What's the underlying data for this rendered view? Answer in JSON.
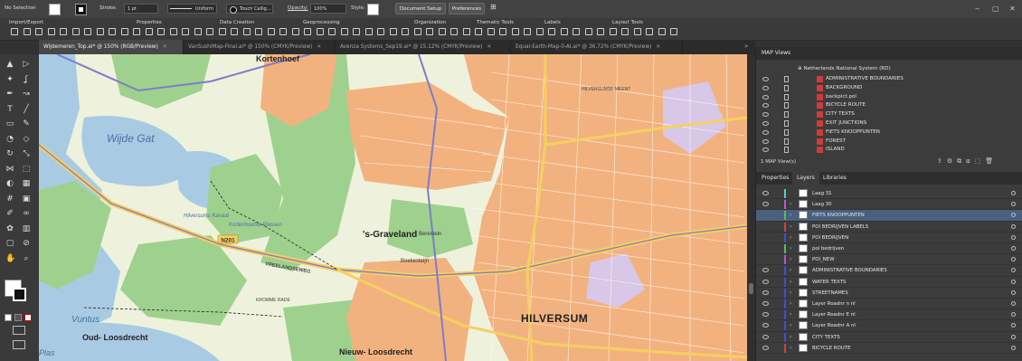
{
  "control_bar": {
    "selection": "No Selection",
    "stroke_label": "Stroke:",
    "stroke_weight": "1 pt",
    "profile": "Uniform",
    "brush": "Touch Callig...",
    "opacity_label": "Opacity:",
    "opacity_value": "100%",
    "style_label": "Style:",
    "doc_setup": "Document Setup",
    "preferences": "Preferences",
    "window_min": "‒",
    "window_max": "▢",
    "window_close": "✕"
  },
  "mapviews_toolbar": {
    "groups": [
      "Import/Export",
      "Properties",
      "Data Creation",
      "Geoprocessing",
      "Organization",
      "Thematic Tools",
      "Labels",
      "Layout Tools"
    ]
  },
  "tabs": [
    {
      "label": "Wijdemeren_Top.ai* @ 150% (RGB/Preview)",
      "active": true
    },
    {
      "label": "VanSushiMap-Final.ai* @ 150% (CMYK/Preview)",
      "active": false
    },
    {
      "label": "Avenza Systems_Sep19.ai* @ 15.12% (CMYK/Preview)",
      "active": false
    },
    {
      "label": "Equal-Earth-Map-0-AI.ai* @ 36.72% (CMYK/Preview)",
      "active": false
    }
  ],
  "tab_close": "✕",
  "tab_overflow": "»",
  "tools": [
    "selection-tool",
    "direct-selection-tool",
    "magic-wand-tool",
    "lasso-tool",
    "pen-tool",
    "curvature-tool",
    "type-tool",
    "line-tool",
    "rectangle-tool",
    "paintbrush-tool",
    "shaper-tool",
    "eraser-tool",
    "rotate-tool",
    "scale-tool",
    "width-tool",
    "free-transform-tool",
    "shape-builder-tool",
    "perspective-tool",
    "mesh-tool",
    "gradient-tool",
    "eyedropper-tool",
    "blend-tool",
    "symbol-sprayer-tool",
    "graph-tool",
    "artboard-tool",
    "slice-tool",
    "hand-tool",
    "zoom-tool"
  ],
  "tool_glyphs": [
    "▲",
    "▷",
    "✦",
    "ʆ",
    "✒",
    "↝",
    "T",
    "╱",
    "▭",
    "✎",
    "◔",
    "◇",
    "↻",
    "⤡",
    "⋈",
    "⬚",
    "◐",
    "▦",
    "#",
    "▣",
    "✐",
    "∞",
    "✿",
    "▥",
    "▢",
    "⊘",
    "✋",
    "⌕"
  ],
  "map": {
    "water_color": "#a8cbe3",
    "urban_color": "#f2b27f",
    "green_color": "#9fd18e",
    "land_color": "#eef2dc",
    "labels": {
      "kortenhoef": "Kortenhoef",
      "wijde_gat": "Wijde Gat",
      "graveland": "'s-Graveland",
      "hilversum": "HILVERSUM",
      "vuntus": "Vuntus",
      "oud_loosdrecht": "Oud-\nLoosdrecht",
      "nieuw_loosdrecht": "Nieuw-\nLoosdrecht",
      "plas": "Plas",
      "n201": "N201",
      "hilversums_kanaal": "Hilversums\nKanaal",
      "kortenhoefse_plassen": "Kortenhoefse\nPlassen",
      "vreelandseweg": "VREELANDSEWEG",
      "kromme_rade": "KROMME RADE",
      "boekesteijn": "Boekesteijn",
      "berestein": "Berestein",
      "hilversumse_meent": "HILVERSUMSE MEENT"
    }
  },
  "map_views_panel": {
    "title": "MAP Views",
    "root": "Netherlands National System (RD)",
    "items": [
      "ADMINISTRATIVE BOUNDARIES",
      "BACKGROUND",
      "backpict.pol",
      "BICYCLE ROUTE",
      "CITY TEXTS",
      "EXIT JUNCTIONS",
      "FIETS KNOOPPUNTEN",
      "FOREST",
      "ISLAND"
    ],
    "footer": "1 MAP View(s)"
  },
  "panel_tabs": [
    "Properties",
    "Layers",
    "Libraries"
  ],
  "layers": [
    {
      "name": "Laag 31",
      "color": "#4fd0d0",
      "eye": true,
      "expand": false
    },
    {
      "name": "Laag 30",
      "color": "#d04fd0",
      "eye": true,
      "expand": true
    },
    {
      "name": "FIETS KNOOPPUNTEN",
      "color": "#52c052",
      "eye": false,
      "expand": true,
      "selected": true
    },
    {
      "name": "POI BEDRIJVEN LABELS",
      "color": "#d04040",
      "eye": false,
      "expand": true
    },
    {
      "name": "POI BEDRIJVEN",
      "color": "#4050d0",
      "eye": false,
      "expand": true
    },
    {
      "name": "poi bedrijven",
      "color": "#52c052",
      "eye": false,
      "expand": true
    },
    {
      "name": "POI_NEW",
      "color": "#c050c0",
      "eye": false,
      "expand": true
    },
    {
      "name": "ADMINISTRATIVE BOUNDARIES",
      "color": "#4050d0",
      "eye": true,
      "expand": true
    },
    {
      "name": "WATER TEXTS",
      "color": "#4050d0",
      "eye": true,
      "expand": true
    },
    {
      "name": "STREETNAMES",
      "color": "#4050d0",
      "eye": true,
      "expand": true
    },
    {
      "name": "Layer Roadnr n nl",
      "color": "#4050d0",
      "eye": true,
      "expand": true
    },
    {
      "name": "Layer Roadnr E nl",
      "color": "#4050d0",
      "eye": true,
      "expand": true
    },
    {
      "name": "Layer Roadnr A nl",
      "color": "#4050d0",
      "eye": true,
      "expand": true
    },
    {
      "name": "CITY TEXTS",
      "color": "#4050d0",
      "eye": true,
      "expand": true
    },
    {
      "name": "BICYCLE ROUTE",
      "color": "#d04040",
      "eye": true,
      "expand": true
    }
  ]
}
